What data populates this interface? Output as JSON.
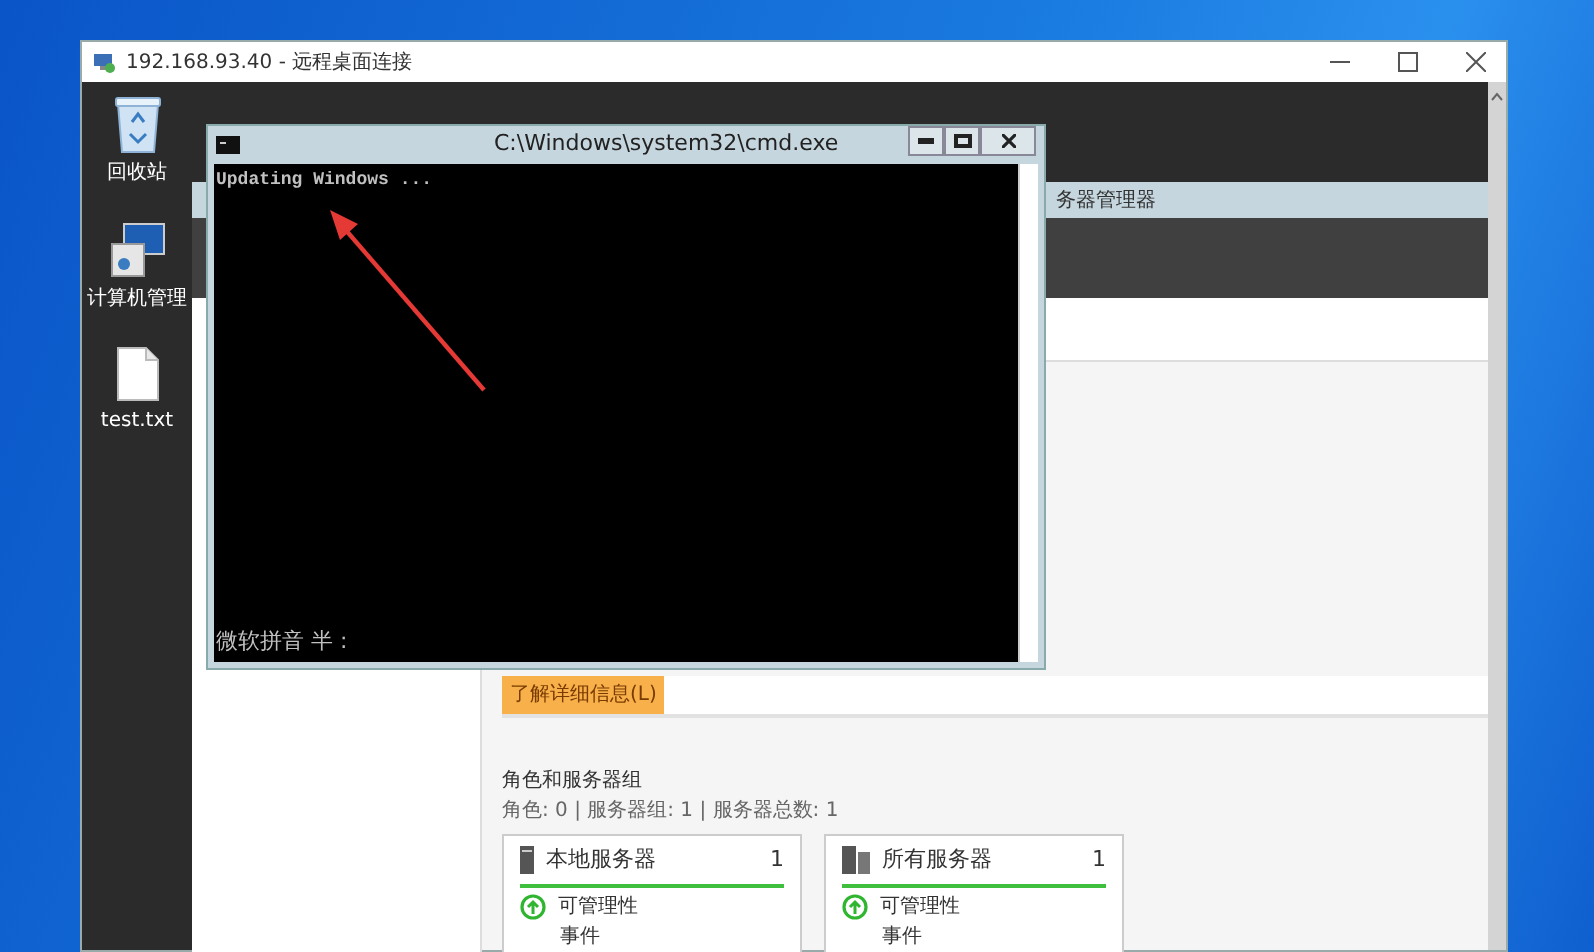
{
  "rdp_window": {
    "title": "192.168.93.40 - 远程桌面连接"
  },
  "desktop_icons": [
    {
      "kind": "recycle",
      "label": "回收站"
    },
    {
      "kind": "computer",
      "label": "计算机管理"
    },
    {
      "kind": "file",
      "label": "test.txt"
    }
  ],
  "server_manager": {
    "title": "务器管理器",
    "learn_more_button": "了解详细信息(L)",
    "section_title": "角色和服务器组",
    "section_summary": "角色: 0 | 服务器组: 1 | 服务器总数: 1",
    "tiles": [
      {
        "kind": "single",
        "title": "本地服务器",
        "count": "1",
        "status": "可管理性",
        "item": "事件"
      },
      {
        "kind": "group",
        "title": "所有服务器",
        "count": "1",
        "status": "可管理性",
        "item": "事件"
      }
    ]
  },
  "cmd_window": {
    "title": "C:\\Windows\\system32\\cmd.exe",
    "lines": [
      "Updating Windows ..."
    ],
    "ime_status": "微软拼音 半 :"
  }
}
